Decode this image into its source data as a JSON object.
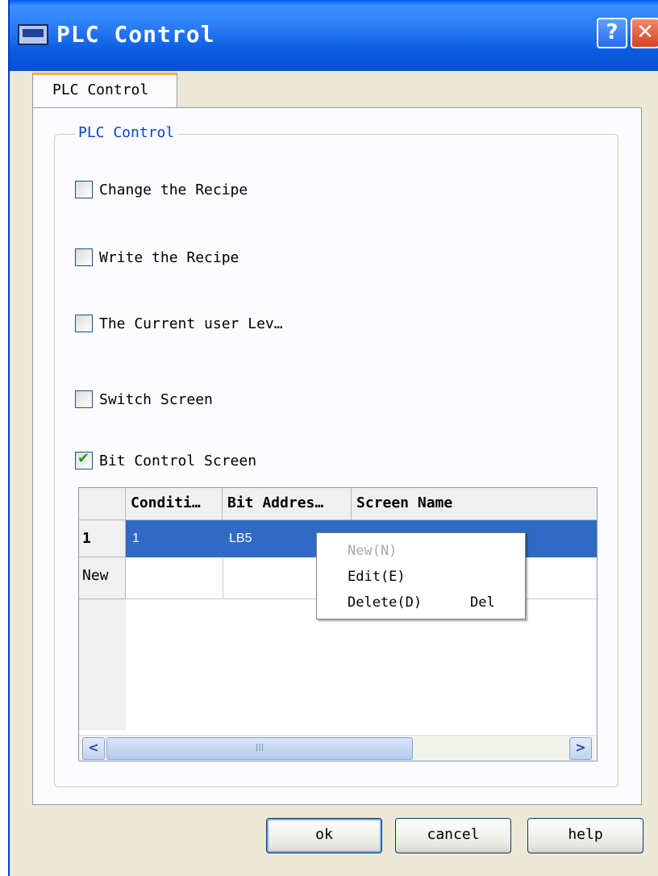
{
  "window": {
    "title": "PLC Control"
  },
  "tabs": [
    {
      "label": "PLC Control"
    }
  ],
  "group": {
    "label": "PLC Control"
  },
  "options": [
    {
      "label": "Change the Recipe",
      "checked": false
    },
    {
      "label": "Write the Recipe",
      "checked": false
    },
    {
      "label": "The Current user Lev…",
      "checked": false
    },
    {
      "label": "Switch Screen",
      "checked": false
    },
    {
      "label": "Bit Control Screen",
      "checked": true
    }
  ],
  "table": {
    "columns": [
      "Conditi…",
      "Bit Addres…",
      "Screen Name"
    ],
    "rows": [
      {
        "label": "1",
        "cells": [
          "1",
          "LB5",
          ""
        ]
      },
      {
        "label": "New",
        "cells": [
          "",
          "",
          ""
        ]
      }
    ],
    "scroll_thumb": "III"
  },
  "context_menu": {
    "items": [
      {
        "label": "New(N)",
        "enabled": false
      },
      {
        "label": "Edit(E)",
        "enabled": true
      },
      {
        "label": "Delete(D)",
        "enabled": true,
        "shortcut": "Del"
      }
    ]
  },
  "buttons": {
    "ok": "ok",
    "cancel": "cancel",
    "help": "help"
  },
  "colors": {
    "title_bar": "#0a5ee0",
    "selection": "#316ac5",
    "check": "#21a121"
  }
}
